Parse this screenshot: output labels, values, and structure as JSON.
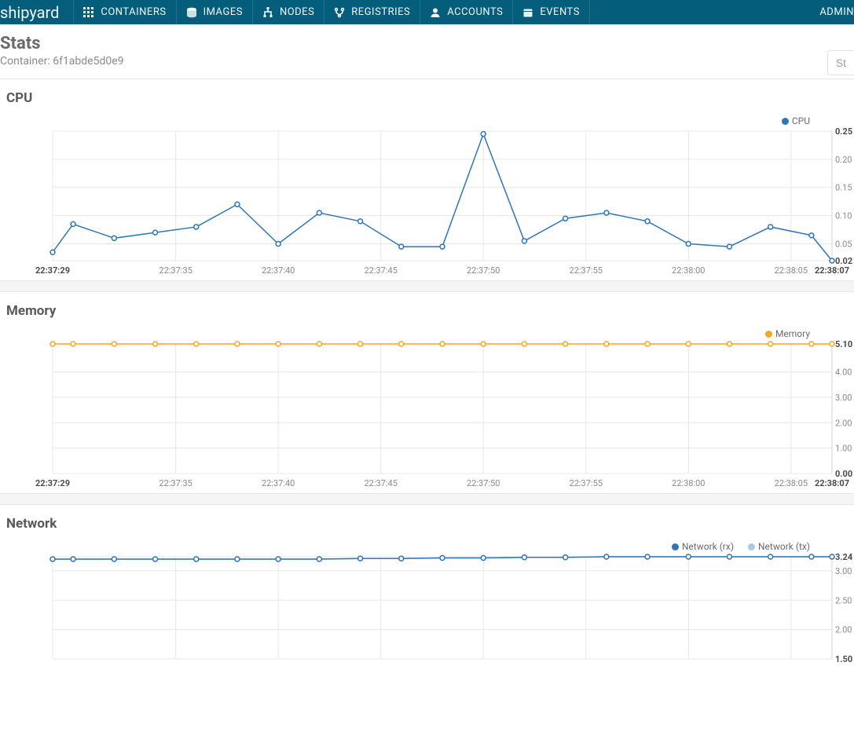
{
  "nav": {
    "logo": "shipyard",
    "items": [
      {
        "icon": "grid",
        "label": "CONTAINERS"
      },
      {
        "icon": "disk",
        "label": "IMAGES"
      },
      {
        "icon": "tree",
        "label": "NODES"
      },
      {
        "icon": "fork",
        "label": "REGISTRIES"
      },
      {
        "icon": "person",
        "label": "ACCOUNTS"
      },
      {
        "icon": "calendar",
        "label": "EVENTS"
      }
    ],
    "admin": "ADMIN"
  },
  "header": {
    "title": "Stats",
    "sub_prefix": "Container: ",
    "sub_value": "6f1abde5d0e9",
    "tab_label": "St"
  },
  "sections": {
    "cpu": "CPU",
    "memory": "Memory",
    "network": "Network"
  },
  "chart_data": [
    {
      "id": "cpu",
      "type": "line",
      "title": "CPU",
      "xlabel": "",
      "ylabel": "",
      "ylim": [
        0.02,
        0.25
      ],
      "x": [
        "22:37:29",
        "22:37:30",
        "22:37:32",
        "22:37:34",
        "22:37:36",
        "22:37:38",
        "22:37:40",
        "22:37:42",
        "22:37:44",
        "22:37:46",
        "22:37:48",
        "22:37:50",
        "22:37:52",
        "22:37:54",
        "22:37:56",
        "22:37:58",
        "22:38:00",
        "22:38:02",
        "22:38:04",
        "22:38:06",
        "22:38:07"
      ],
      "x_ticks": [
        "22:37:29",
        "22:37:35",
        "22:37:40",
        "22:37:45",
        "22:37:50",
        "22:37:55",
        "22:38:00",
        "22:38:05",
        "22:38:07"
      ],
      "y_ticks": [
        0.02,
        0.05,
        0.1,
        0.15,
        0.2,
        0.25
      ],
      "series": [
        {
          "name": "CPU",
          "color": "#2f76b8",
          "values": [
            0.035,
            0.085,
            0.06,
            0.07,
            0.08,
            0.12,
            0.05,
            0.105,
            0.09,
            0.045,
            0.045,
            0.245,
            0.055,
            0.095,
            0.105,
            0.09,
            0.05,
            0.045,
            0.08,
            0.065,
            0.02
          ]
        }
      ]
    },
    {
      "id": "memory",
      "type": "line",
      "title": "Memory",
      "xlabel": "",
      "ylabel": "",
      "ylim": [
        0.0,
        5.1
      ],
      "x": [
        "22:37:29",
        "22:37:30",
        "22:37:32",
        "22:37:34",
        "22:37:36",
        "22:37:38",
        "22:37:40",
        "22:37:42",
        "22:37:44",
        "22:37:46",
        "22:37:48",
        "22:37:50",
        "22:37:52",
        "22:37:54",
        "22:37:56",
        "22:37:58",
        "22:38:00",
        "22:38:02",
        "22:38:04",
        "22:38:06",
        "22:38:07"
      ],
      "x_ticks": [
        "22:37:29",
        "22:37:35",
        "22:37:40",
        "22:37:45",
        "22:37:50",
        "22:37:55",
        "22:38:00",
        "22:38:05",
        "22:38:07"
      ],
      "y_ticks": [
        0.0,
        1.0,
        2.0,
        3.0,
        4.0,
        5.1
      ],
      "series": [
        {
          "name": "Memory",
          "color": "#f5a623",
          "values": [
            5.1,
            5.1,
            5.1,
            5.1,
            5.1,
            5.1,
            5.1,
            5.1,
            5.1,
            5.1,
            5.1,
            5.1,
            5.1,
            5.1,
            5.1,
            5.1,
            5.1,
            5.1,
            5.1,
            5.1,
            5.1
          ]
        }
      ]
    },
    {
      "id": "network",
      "type": "line",
      "title": "Network",
      "xlabel": "",
      "ylabel": "",
      "ylim": [
        1.5,
        3.24
      ],
      "x": [
        "22:37:29",
        "22:37:30",
        "22:37:32",
        "22:37:34",
        "22:37:36",
        "22:37:38",
        "22:37:40",
        "22:37:42",
        "22:37:44",
        "22:37:46",
        "22:37:48",
        "22:37:50",
        "22:37:52",
        "22:37:54",
        "22:37:56",
        "22:37:58",
        "22:38:00",
        "22:38:02",
        "22:38:04",
        "22:38:06",
        "22:38:07"
      ],
      "x_ticks": [
        "22:37:29",
        "22:37:35",
        "22:37:40",
        "22:37:45",
        "22:37:50",
        "22:37:55",
        "22:38:00",
        "22:38:05",
        "22:38:07"
      ],
      "y_ticks": [
        1.5,
        2.0,
        2.5,
        3.0,
        3.24
      ],
      "series": [
        {
          "name": "Network (rx)",
          "color": "#2f76b8",
          "values": [
            3.2,
            3.2,
            3.2,
            3.2,
            3.2,
            3.2,
            3.2,
            3.2,
            3.21,
            3.21,
            3.22,
            3.22,
            3.23,
            3.23,
            3.24,
            3.24,
            3.24,
            3.24,
            3.24,
            3.24,
            3.24
          ]
        },
        {
          "name": "Network (tx)",
          "color": "#a9c9e4",
          "values": [
            3.2,
            3.2,
            3.2,
            3.2,
            3.2,
            3.2,
            3.2,
            3.2,
            3.21,
            3.21,
            3.22,
            3.22,
            3.23,
            3.23,
            3.24,
            3.24,
            3.24,
            3.24,
            3.24,
            3.24,
            3.24
          ]
        }
      ]
    }
  ]
}
